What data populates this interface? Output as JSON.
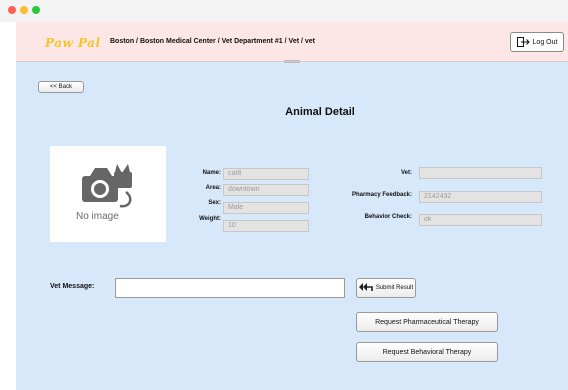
{
  "app": {
    "brand": "Paw Pal",
    "breadcrumb": "Boston / Boston Medical Center / Vet Department #1 / Vet / vet"
  },
  "header": {
    "logout_label": "Log Out"
  },
  "nav": {
    "back_label": "<< Back"
  },
  "page": {
    "title": "Animal Detail"
  },
  "photo": {
    "placeholder_text": "No image"
  },
  "animal": {
    "name_label": "Name:",
    "name_value": "cat8",
    "area_label": "Area:",
    "area_value": "downtown",
    "sex_label": "Sex:",
    "sex_value": "Male",
    "weight_label": "Weight:",
    "weight_value": "10"
  },
  "review": {
    "vet_label": "Vet:",
    "vet_value": "",
    "pharmacy_label": "Pharmacy Feedback:",
    "pharmacy_value": "2142432",
    "behavior_label": "Behavior Check:",
    "behavior_value": "ok"
  },
  "message": {
    "label": "Vet Message:",
    "value": ""
  },
  "actions": {
    "submit_label": "Submit Result",
    "pharm_label": "Request Pharmaceutical Therapy",
    "behav_label": "Request Behavioral Therapy"
  }
}
